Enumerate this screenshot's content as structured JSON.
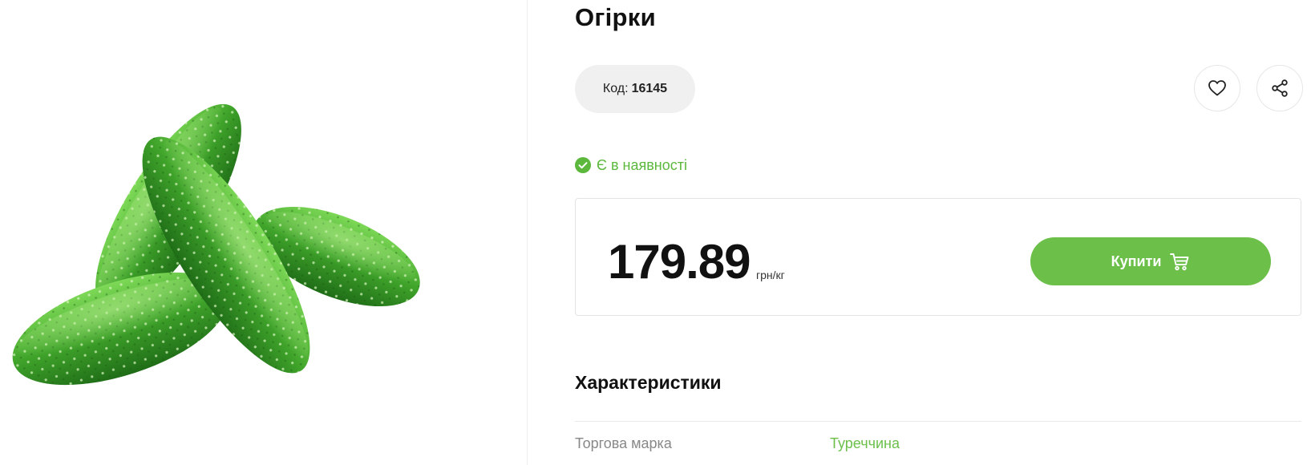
{
  "product": {
    "title": "Огірки",
    "code_label": "Код:",
    "code_value": "16145",
    "availability": "Є в наявності",
    "price": "179.89",
    "price_unit": "грн/кг",
    "buy_label": "Купити",
    "image_icon": "cucumber-product-photo"
  },
  "actions": {
    "favorite_icon": "heart-icon",
    "share_icon": "share-icon"
  },
  "specs": {
    "title": "Характеристики",
    "rows": [
      {
        "label": "Торгова марка",
        "value": "Туреччина"
      }
    ]
  },
  "colors": {
    "accent": "#6cc04a",
    "availability": "#5cb83c",
    "pill_bg": "#f0f0f0"
  }
}
